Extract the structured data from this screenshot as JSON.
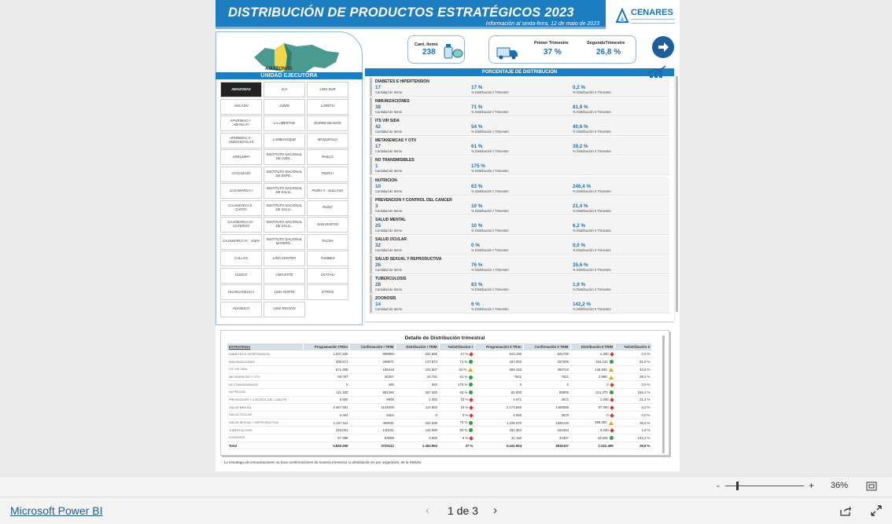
{
  "report": {
    "title": "DISTRIBUCIÓN DE PRODUCTOS ESTRATÉGICOS 2023",
    "subtitle": "Información al sexta-feira, 12 de maio de 2023",
    "logo_text": "CENARES"
  },
  "map": {
    "label": "AMAZONAS"
  },
  "unit_header": "UNIDAD EJECUTORA",
  "units": [
    [
      "AMAZONAS",
      "ICA",
      "LIMA SUR"
    ],
    [
      "ANCASH",
      "JUNIN",
      "LORETO"
    ],
    [
      "APURIMAC I - ABANCAY",
      "LA LIBERTAD",
      "MADRE DE DIOS"
    ],
    [
      "APURIMAC II - ANDAHUAYLAS",
      "LAMBAYEQUE",
      "MOQUEGUA"
    ],
    [
      "AREQUIPA",
      "INSTITUTO NACIONAL DE CIEN...",
      "PASCO"
    ],
    [
      "AYACUCHO",
      "INSTITUTO NACIONAL DE ENFE...",
      "PIURA I"
    ],
    [
      "CAJAMARCA I",
      "INSTITUTO NACIONAL DE SALU...",
      "PIURA II - SULLANA"
    ],
    [
      "CAJAMARCA II - CHOTA",
      "INSTITUTO NACIONAL DE SALU...",
      "PUNO"
    ],
    [
      "CAJAMARCA III - CUTERVO",
      "INSTITUTO NACIONAL DE SALU...",
      "SAN MARTIN"
    ],
    [
      "CAJAMARCA IV - JAEN",
      "INSTITUTO NACIONAL MATERN...",
      "TACNA"
    ],
    [
      "CALLAO",
      "LIMA CENTRO",
      "TUMBES"
    ],
    [
      "CUSCO",
      "LIMA ESTE",
      "UCAYALI"
    ],
    [
      "HUANCAVELICA",
      "LIMA NORTE",
      "OTROS"
    ],
    [
      "HUANUCO",
      "LIMA REGION",
      ""
    ]
  ],
  "kpis": {
    "items_label": "Cant. Items",
    "items_value": "238",
    "t1_label": "Primer Trimestre",
    "t1_value": "37 %",
    "t2_label": "SegundoTrimestre",
    "t2_value": "26,8 %"
  },
  "dist_header": "PORCENTAJE DE DISTRIBUCIÓN",
  "dist_labels": {
    "qty": "Cantidad de Items",
    "t1": "% Distribución I Trimestre",
    "t2": "% Distribución II Trimestre"
  },
  "distribution": [
    {
      "name": "DIABETES E HIPERTENSION",
      "qty": "17",
      "t1": "17 %",
      "t2": "0,2 %"
    },
    {
      "name": "INMUNIZACIONES",
      "qty": "38",
      "t1": "71 %",
      "t2": "81,9 %"
    },
    {
      "name": "ITS VIH SIDA",
      "qty": "42",
      "t1": "54 %",
      "t2": "40,6 %"
    },
    {
      "name": "METAXENICAS Y OTV",
      "qty": "17",
      "t1": "61 %",
      "t2": "39,2 %"
    },
    {
      "name": "NO TRANSMISIBLES",
      "qty": "1",
      "t1": "175 %",
      "t2": ""
    },
    {
      "name": "NUTRICION",
      "qty": "10",
      "t1": "63 %",
      "t2": "246,4 %"
    },
    {
      "name": "PREVENCION Y CONTROL DEL CANCER",
      "qty": "3",
      "t1": "10 %",
      "t2": "21,4 %"
    },
    {
      "name": "SALUD MENTAL",
      "qty": "25",
      "t1": "10 %",
      "t2": "6,2 %"
    },
    {
      "name": "SALUD OCULAR",
      "qty": "32",
      "t1": "0 %",
      "t2": "0,0 %"
    },
    {
      "name": "SALUD SEXUAL Y REPRODUCTIVA",
      "qty": "26",
      "t1": "76 %",
      "t2": "35,6 %"
    },
    {
      "name": "TUBERCULOSIS",
      "qty": "28",
      "t1": "83 %",
      "t2": "1,9 %"
    },
    {
      "name": "ZOONOSIS",
      "qty": "14",
      "t1": "6 %",
      "t2": "142,2 %"
    }
  ],
  "detail": {
    "title": "Detalle de Distribución trimestral",
    "columns": [
      "ESTRATEGIA",
      "Programación ITRim",
      "Confirmación I TRIM",
      "Distribución I TRIM",
      "%Distribucion I",
      "Programación II TRim",
      "Confirmación II TRIM",
      "Distribución II TRIM",
      "%Distribución II"
    ],
    "rows": [
      [
        "DIABETES E HIPERTENSION",
        "1.037.150",
        "898950",
        "151.655",
        "17 %",
        "red",
        "813.150",
        "521700",
        "1.000",
        "red",
        "0,2 %"
      ],
      [
        "INMUNIZACIONES",
        "208.571",
        "208571",
        "147.874",
        "71 %",
        "green",
        "187.000",
        "187000",
        "153.210",
        "green",
        "81,9 %"
      ],
      [
        "ITS VIH SIDA",
        "571.308",
        "189418",
        "102.807",
        "54 %",
        "amber",
        "559.153",
        "360713",
        "146.935",
        "amber",
        "40,6 %"
      ],
      [
        "METAXENICAS Y OTV",
        "56.787",
        "40257",
        "24.751",
        "61 %",
        "green",
        "7621",
        "7621",
        "2.988",
        "amber",
        "39,2 %"
      ],
      [
        "NO TRANSMISIBLES",
        "0",
        "480",
        "840",
        "175 %",
        "green",
        "0",
        "0",
        "0",
        "red",
        "0,0 %"
      ],
      [
        "NUTRICION",
        "111.450",
        "581290",
        "367.000",
        "63 %",
        "green",
        "82.500",
        "85800",
        "211.370",
        "green",
        "246,4 %"
      ],
      [
        "PREVENCION Y CONTROL DEL CANCER",
        "9.900",
        "9900",
        "1.000",
        "10 %",
        "red",
        "4.671",
        "4671",
        "1.000",
        "red",
        "21,4 %"
      ],
      [
        "SALUD MENTAL",
        "2.457.681",
        "1144000",
        "114.800",
        "10 %",
        "red",
        "2.273.655",
        "1408056",
        "87.000",
        "red",
        "6,2 %"
      ],
      [
        "SALUD OCULAR",
        "6.364",
        "6364",
        "0",
        "0 %",
        "red",
        "4.050",
        "3670",
        "0",
        "red",
        "0,0 %"
      ],
      [
        "SALUD SEXUAL Y REPRODUCTIVA",
        "1.107.311",
        "459031",
        "322.630",
        "76 %",
        "green",
        "1.105.070",
        "1026120",
        "369.350",
        "amber",
        "35,6 %"
      ],
      [
        "TUBERCULOSIS",
        "315.051",
        "140151",
        "116.590",
        "83 %",
        "green",
        "181.304",
        "162454",
        "3.030",
        "red",
        "1,9 %"
      ],
      [
        "ZOONOSIS",
        "57.398",
        "63088",
        "3.500",
        "6 %",
        "red",
        "31.150",
        "31307",
        "44.525",
        "green",
        "142,2 %"
      ]
    ],
    "total": [
      "Total",
      "5.840.269",
      "3720112",
      "1.363.953",
      "37 %",
      "5.241.904",
      "3816107",
      "1.022.499",
      "26,8 %"
    ]
  },
  "footnote": "- La estrategia de inmunizaciones no hace confirmaciones de manera trimestral, la distribución es por asignación, de la DMUNI",
  "viewer": {
    "zoom": "36%",
    "minus": "-",
    "plus": "+",
    "brand": "Microsoft Power BI",
    "page": "1 de 3"
  }
}
